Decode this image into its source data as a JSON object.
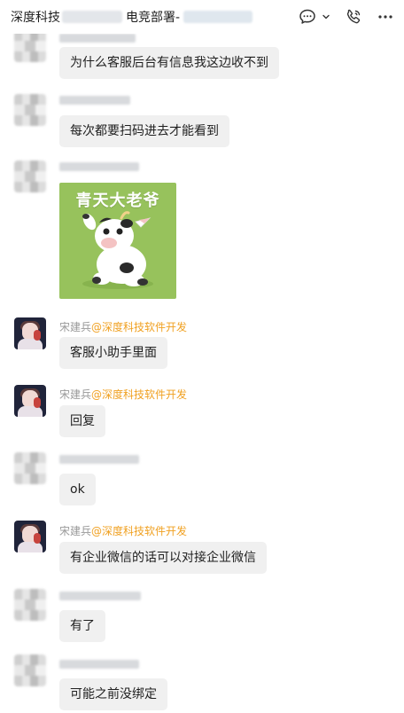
{
  "header": {
    "title_prefix": "深度科技",
    "title_middle": "电竞部署-",
    "icons": [
      "chat-icon",
      "chevron-down-icon",
      "phone-icon",
      "more-icon"
    ]
  },
  "messages": [
    {
      "type": "text",
      "sender": "redacted",
      "text": "为什么客服后台有信息我这边收不到"
    },
    {
      "type": "text",
      "sender": "redacted",
      "text": "每次都要扫码进去才能看到"
    },
    {
      "type": "sticker",
      "sender": "redacted",
      "sticker_text": "青天大老爷"
    },
    {
      "type": "text",
      "sender_name": "宋建兵",
      "sender_org": "@深度科技软件开发",
      "text": "客服小助手里面"
    },
    {
      "type": "text",
      "sender_name": "宋建兵",
      "sender_org": "@深度科技软件开发",
      "text": "回复"
    },
    {
      "type": "text",
      "sender": "redacted",
      "text": "ok"
    },
    {
      "type": "text",
      "sender_name": "宋建兵",
      "sender_org": "@深度科技软件开发",
      "text": "有企业微信的话可以对接企业微信"
    },
    {
      "type": "text",
      "sender": "redacted",
      "text": "有了"
    },
    {
      "type": "text",
      "sender": "redacted",
      "text": "可能之前没绑定"
    }
  ],
  "colors": {
    "bubble": "#f0f0f0",
    "org_tag": "#f0a020",
    "sender_name": "#999999",
    "sticker_bg": "#97c25c"
  }
}
